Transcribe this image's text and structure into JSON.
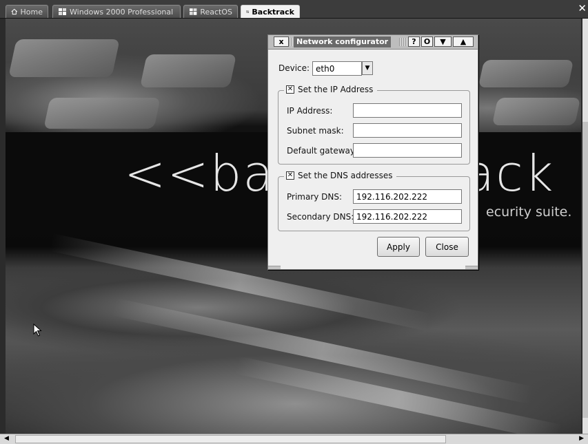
{
  "tabs": [
    {
      "label": "Home",
      "icon": "home-icon"
    },
    {
      "label": "Windows 2000 Professional",
      "icon": "vm-icon"
    },
    {
      "label": "ReactOS",
      "icon": "vm-icon"
    },
    {
      "label": "Backtrack",
      "icon": "vm-icon",
      "active": true
    }
  ],
  "wallpaper": {
    "logo_left": "<<ba",
    "logo_right": "ack",
    "tagline": "ecurity suite."
  },
  "dialog": {
    "title": "Network configurator",
    "title_buttons": [
      "x",
      "?",
      "O",
      "▼",
      "▲"
    ],
    "device_label": "Device:",
    "device_value": "eth0",
    "ip_group": {
      "label": "Set the IP Address",
      "checked": true,
      "ip_label": "IP Address:",
      "ip_value": "",
      "mask_label": "Subnet mask:",
      "mask_value": "",
      "gateway_label": "Default gateway:",
      "gateway_value": ""
    },
    "dns_group": {
      "label": "Set the DNS addresses",
      "checked": true,
      "primary_label": "Primary DNS:",
      "primary_value": "192.116.202.222",
      "secondary_label": "Secondary DNS:",
      "secondary_value": "192.116.202.222"
    },
    "apply_label": "Apply",
    "close_label": "Close"
  },
  "colors": {
    "dialog_bg": "#efefef",
    "title_bg": "#6a6a6a",
    "desktop_dark": "#0b0b0b"
  }
}
